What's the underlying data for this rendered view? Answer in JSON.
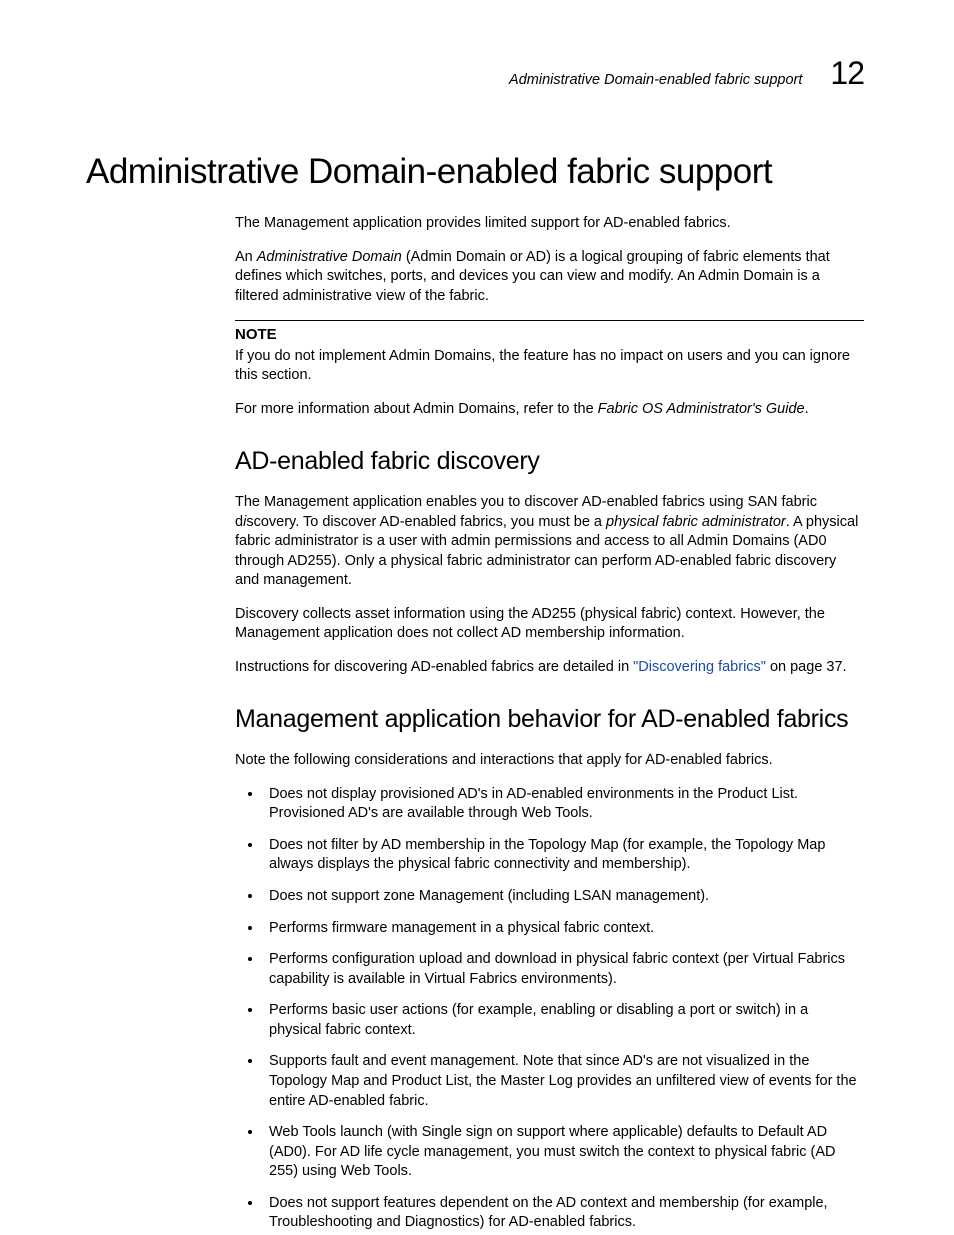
{
  "header": {
    "running_title": "Administrative Domain-enabled fabric support",
    "chapter_number": "12"
  },
  "title": "Administrative Domain-enabled fabric support",
  "intro": {
    "p1": "The Management application provides limited support for AD-enabled fabrics.",
    "p2_pre": "An ",
    "p2_em": "Administrative Domain",
    "p2_post": " (Admin Domain or AD) is a logical grouping of fabric elements that defines which switches, ports, and devices you can view and modify. An Admin Domain is a filtered administrative view of the fabric."
  },
  "note": {
    "label": "NOTE",
    "text": "If you do not implement Admin Domains, the feature has no impact on users and you can ignore this section."
  },
  "more_info": {
    "pre": "For more information about Admin Domains, refer to the ",
    "em": "Fabric OS Administrator's Guide",
    "post": "."
  },
  "discovery": {
    "heading": "AD-enabled fabric discovery",
    "p1_a": "The Management application enables you to discover AD-enabled fabrics using SAN fabric d",
    "p1_b": "i",
    "p1_c": "scovery. To discover AD-enabled fabrics, you must be a ",
    "p1_em": "physical fabric administrator",
    "p1_d": ". A physical fabric administrator is a user with admin permissions and access to all Admin Domains (AD0 through AD255). Only a physical fabric administrator can perform AD-enabled fabric discovery and management.",
    "p2": "Discovery collects asset information using the AD255 (physical fabric) context. However, the Management application does not collect AD membership information.",
    "p3_pre": "Instructions for discovering AD-enabled fabrics are detailed in ",
    "p3_link": "\"Discovering fabrics\"",
    "p3_post": " on page 37."
  },
  "behavior": {
    "heading": "Management application behavior for AD-enabled fabrics",
    "intro": "Note the following considerations and interactions that apply for AD-enabled fabrics.",
    "bullets": [
      "Does not display provisioned AD's in AD-enabled environments in the Product List. Provisioned AD's are available through Web Tools.",
      "Does not filter by AD membership in the Topology Map (for example, the Topology Map always displays the physical fabric connectivity and membership).",
      "Does not support zone Management (including LSAN management).",
      "Performs firmware management in a physical fabric context.",
      "Performs configuration upload and download in physical fabric context (per Virtual Fabrics capability is available in Virtual Fabrics environments).",
      "Performs basic user actions (for example, enabling or disabling a port or switch) in a physical fabric context.",
      "Supports fault and event management. Note that since AD's are not visualized in the Topology Map and Product List, the Master Log provides an unfiltered view of events for the entire AD-enabled fabric.",
      "Web Tools launch (with Single sign on support where applicable) defaults to Default AD (AD0). For AD life cycle management, you must switch the context to physical fabric (AD 255) using Web Tools.",
      "Does not support features dependent on the AD context and membership (for example, Troubleshooting and Diagnostics) for AD-enabled fabrics."
    ]
  }
}
